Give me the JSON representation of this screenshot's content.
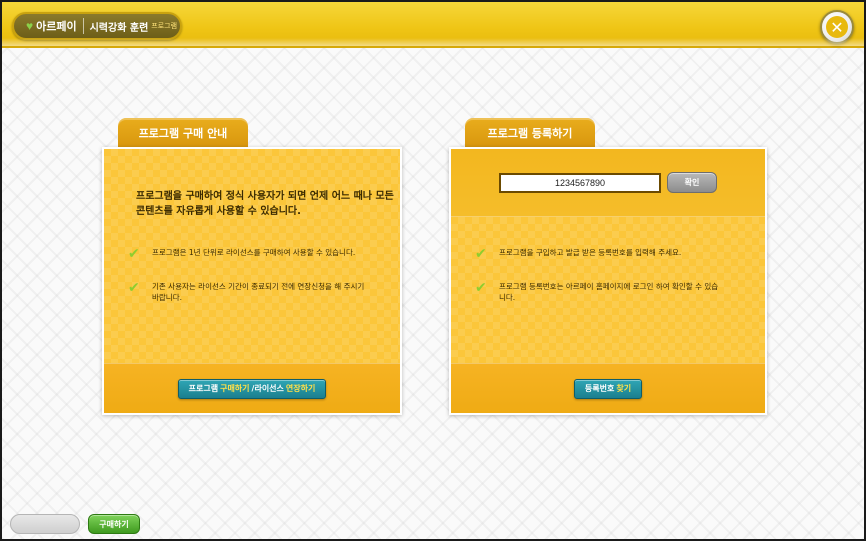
{
  "header": {
    "logo_text": "아르페이",
    "title": "시력강화 훈련",
    "subtitle": "프로그램",
    "close_label": "✕"
  },
  "purchase_panel": {
    "tab_label": "프로그램 구매 안내",
    "lead_text": "프로그램을 구매하여 정식 사용자가 되면 언제 어느 때나 모든 콘텐츠를 자유롭게 사용할 수 있습니다.",
    "bullets": [
      "프로그램은 1년 단위로 라이선스를 구매하여 사용할 수 있습니다.",
      "기존 사용자는 라이선스 기간이 종료되기 전에 연장신청을 해 주시기 바랍니다."
    ],
    "button": {
      "part1": "프로그램 ",
      "part2": "구매하기",
      "part3": "/라이선스 ",
      "part4": "연장하기"
    }
  },
  "register_panel": {
    "tab_label": "프로그램 등록하기",
    "input_value": "1234567890",
    "confirm_label": "확인",
    "bullets": [
      "프로그램을 구입하고 발급 받은 등록번호를 입력해 주세요.",
      "프로그램 등록번호는 아르페이 홈페이지에 로그인 하여 확인할 수 있습니다."
    ],
    "button": {
      "part1": "등록번호 ",
      "part2": "찾기"
    }
  },
  "footer": {
    "buy_label": "구매하기"
  }
}
